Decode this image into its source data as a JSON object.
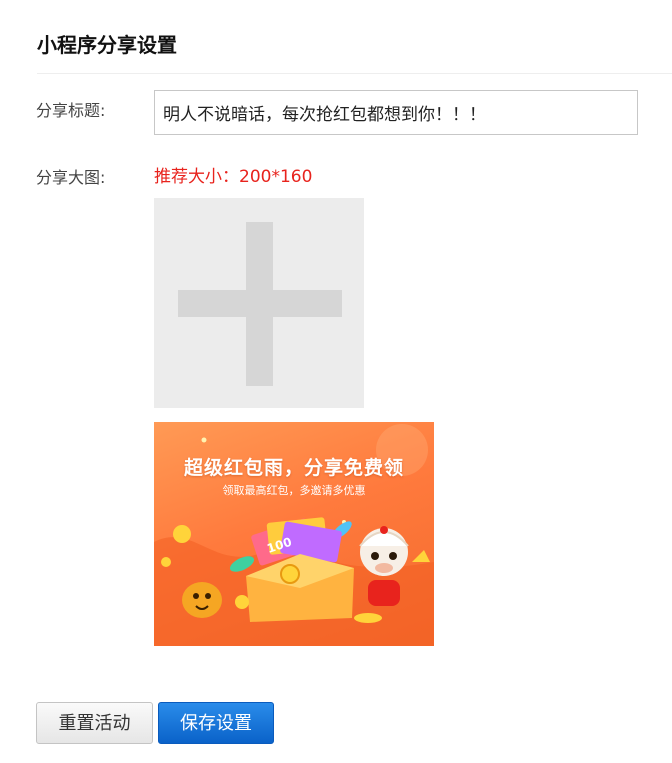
{
  "section": {
    "title": "小程序分享设置"
  },
  "form": {
    "share_title_label": "分享标题:",
    "share_title_value": "明人不说暗话，每次抢红包都想到你！！！",
    "share_image_label": "分享大图:",
    "size_hint": "推荐大小：200*160"
  },
  "upload": {
    "icon": "plus-icon"
  },
  "banner": {
    "headline": "超级红包雨，分享免费领",
    "subtext": "领取最高红包，多邀请多优惠",
    "note_text": "100"
  },
  "actions": {
    "reset_label": "重置活动",
    "save_label": "保存设置"
  },
  "colors": {
    "hint": "#e8231d",
    "primary": "#0a62c9",
    "banner": "#ff7a3d"
  }
}
